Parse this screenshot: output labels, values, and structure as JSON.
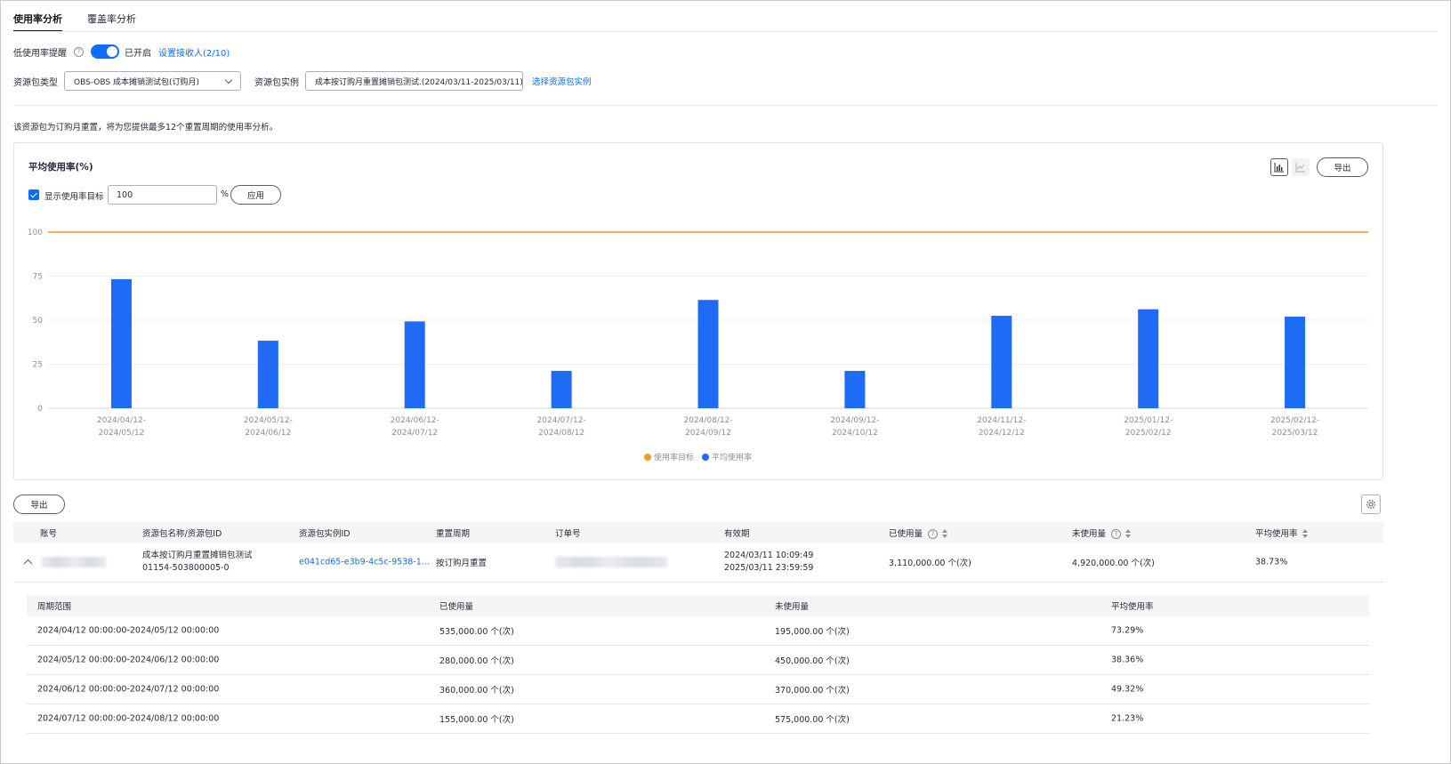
{
  "tabs": [
    {
      "label": "使用率分析",
      "active": true
    },
    {
      "label": "覆盖率分析",
      "active": false
    }
  ],
  "alert": {
    "label": "低使用率提醒",
    "status": "已开启",
    "link": "设置接收人(2/10)"
  },
  "filters": {
    "type_label": "资源包类型",
    "type_value": "OBS-OBS 成本摊销测试包(订购月)",
    "instance_label": "资源包实例",
    "instance_value": "成本按订购月重置摊销包测试.(2024/03/11-2025/03/11)",
    "instance_link": "选择资源包实例"
  },
  "note": "该资源包为订购月重置，将为您提供最多12个重置周期的使用率分析。",
  "chart_panel": {
    "title": "平均使用率(%)",
    "show_target_label": "显示使用率目标",
    "target_value": "100",
    "percent": "%",
    "apply": "应用",
    "export": "导出",
    "bar_icon": "bar-chart-icon",
    "line_icon": "line-chart-icon"
  },
  "chart_data": {
    "type": "bar",
    "categories": [
      [
        "2024/04/12-",
        "2024/05/12"
      ],
      [
        "2024/05/12-",
        "2024/06/12"
      ],
      [
        "2024/06/12-",
        "2024/07/12"
      ],
      [
        "2024/07/12-",
        "2024/08/12"
      ],
      [
        "2024/08/12-",
        "2024/09/12"
      ],
      [
        "2024/09/12-",
        "2024/10/12"
      ],
      [
        "2024/11/12-",
        "2024/12/12"
      ],
      [
        "2025/01/12-",
        "2025/02/12"
      ],
      [
        "2025/02/12-",
        "2025/03/12"
      ]
    ],
    "series": [
      {
        "name": "平均使用率",
        "values": [
          73.29,
          38.36,
          49.32,
          21.23,
          61.5,
          21.2,
          52.5,
          56.2,
          52.0
        ],
        "color": "#1f6bf5"
      }
    ],
    "target": {
      "name": "使用率目标",
      "value": 100,
      "color": "#f59a23"
    },
    "yticks": [
      "0",
      "25",
      "50",
      "75",
      "100"
    ],
    "ylim": [
      0,
      100
    ],
    "grid": true,
    "legend_position": "bottom-center"
  },
  "table_toolbar": {
    "export": "导出",
    "settings_icon": "gear-icon"
  },
  "table": {
    "headers": [
      "账号",
      "资源包名称/资源包ID",
      "资源包实例ID",
      "重置周期",
      "订单号",
      "有效期",
      "已使用量",
      "未使用量",
      "平均使用率"
    ],
    "row": {
      "name": "成本按订购月重置摊销包测试",
      "package_id": "01154-503800005-0",
      "instance_id": "e041cd65-e3b9-4c5c-9538-1...",
      "cycle": "按订购月重置",
      "valid_from": "2024/03/11 10:09:49",
      "valid_to": "2025/03/11 23:59:59",
      "used": "3,110,000.00 个(次)",
      "unused": "4,920,000.00 个(次)",
      "avg": "38.73%"
    }
  },
  "subtable": {
    "headers": [
      "周期范围",
      "已使用量",
      "未使用量",
      "平均使用率"
    ],
    "rows": [
      [
        "2024/04/12 00:00:00-2024/05/12 00:00:00",
        "535,000.00 个(次)",
        "195,000.00 个(次)",
        "73.29%"
      ],
      [
        "2024/05/12 00:00:00-2024/06/12 00:00:00",
        "280,000.00 个(次)",
        "450,000.00 个(次)",
        "38.36%"
      ],
      [
        "2024/06/12 00:00:00-2024/07/12 00:00:00",
        "360,000.00 个(次)",
        "370,000.00 个(次)",
        "49.32%"
      ],
      [
        "2024/07/12 00:00:00-2024/08/12 00:00:00",
        "155,000.00 个(次)",
        "575,000.00 个(次)",
        "21.23%"
      ]
    ]
  }
}
